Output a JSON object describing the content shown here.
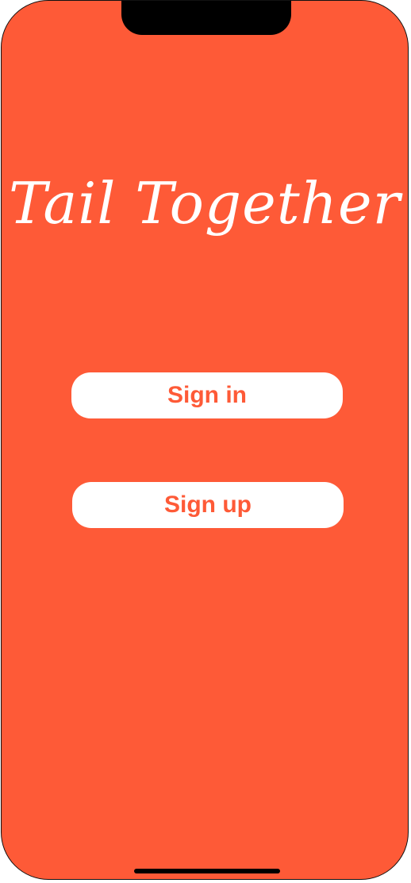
{
  "app": {
    "title": "Tail Together"
  },
  "actions": {
    "sign_in_label": "Sign in",
    "sign_up_label": "Sign up"
  },
  "theme": {
    "background": "#FE5A37",
    "button_background": "#FFFFFF",
    "button_text": "#FE5A37",
    "title_text": "#FFFFFF"
  }
}
